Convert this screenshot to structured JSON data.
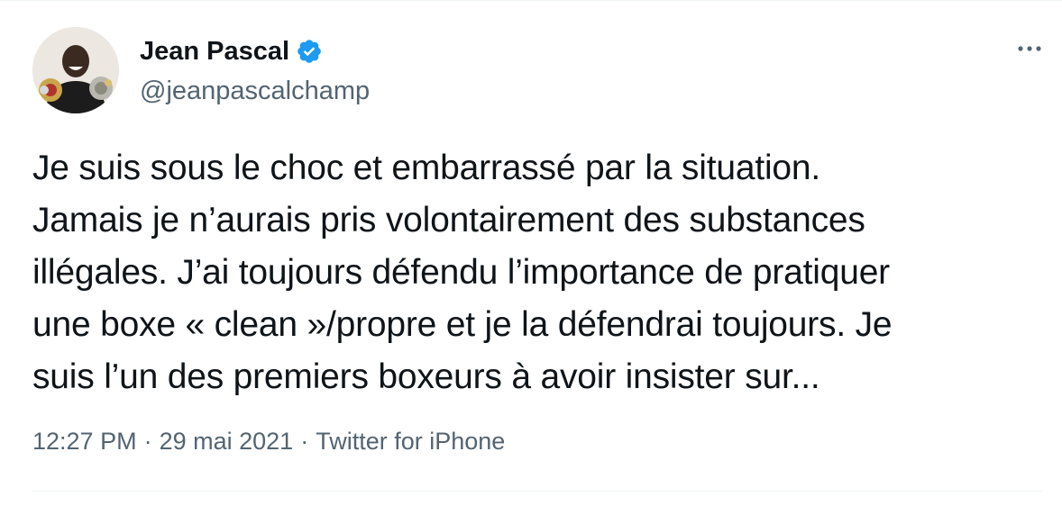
{
  "author": {
    "display_name": "Jean Pascal",
    "handle": "@jeanpascalchamp",
    "verified": true
  },
  "tweet": {
    "text": "Je suis sous le choc et embarrassé par la situation.\nJamais je n’aurais pris volontairement des substances\nillégales. J’ai toujours défendu l’importance de pratiquer\nune boxe « clean »/propre et je la défendrai toujours. Je\nsuis l’un des premiers boxeurs à avoir insister sur..."
  },
  "meta": {
    "time": "12:27 PM",
    "separator": "·",
    "date": "29 mai 2021",
    "source": "Twitter for iPhone"
  },
  "icons": {
    "more": "more-options-icon",
    "verified": "verified-badge-icon",
    "avatar": "avatar"
  },
  "colors": {
    "verified_blue": "#1d9bf0",
    "secondary_text": "#536471",
    "primary_text": "#0f1419"
  }
}
